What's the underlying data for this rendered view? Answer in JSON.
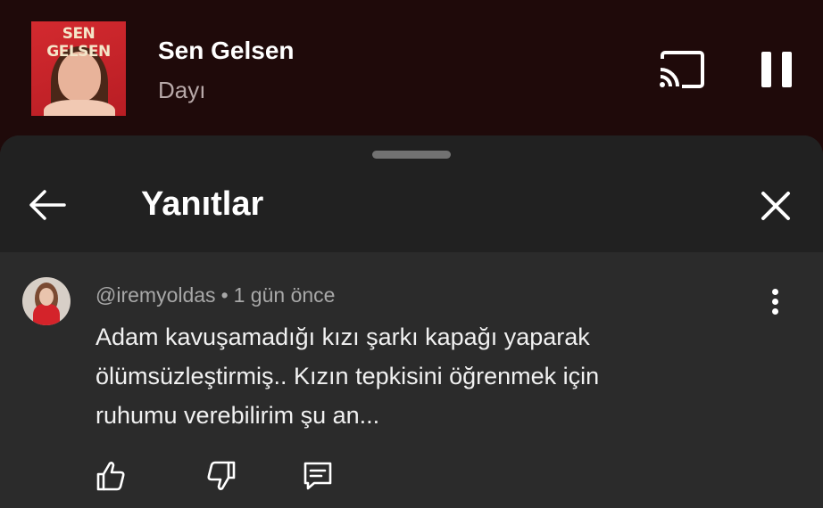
{
  "player": {
    "album_art_text": "SEN GELSEN",
    "song_title": "Sen Gelsen",
    "artist": "Dayı",
    "icons": {
      "cast": "cast-icon",
      "pause": "pause-icon"
    }
  },
  "sheet": {
    "title": "Yanıtlar",
    "icons": {
      "back": "arrow-left-icon",
      "close": "close-icon"
    }
  },
  "comment": {
    "author": "@iremyoldas",
    "separator": "•",
    "time": "1 gün önce",
    "lines": [
      "Adam kavuşamadığı kızı şarkı kapağı yaparak",
      "ölümsüzleştirmiş.. Kızın tepkisini öğrenmek için",
      "ruhumu verebilirim şu an..."
    ],
    "actions": [
      "thumbs-up-icon",
      "thumbs-down-icon",
      "comment-icon"
    ]
  },
  "colors": {
    "player_bg": "#1f0a0a",
    "sheet_header_bg": "#212121",
    "sheet_body_bg": "#2b2b2b",
    "meta_text": "#a8a8a8"
  }
}
